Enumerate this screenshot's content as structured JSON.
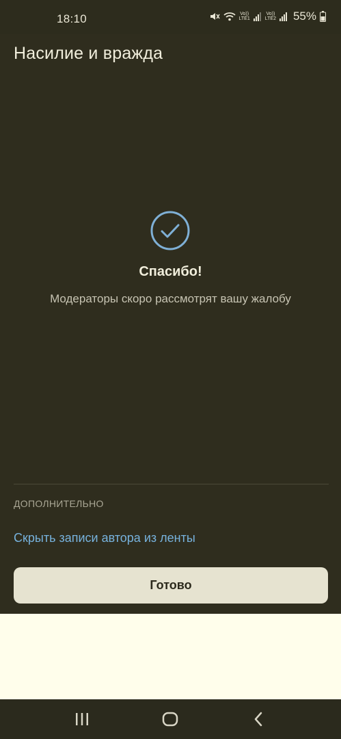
{
  "status_bar": {
    "time": "18:10",
    "lte1": "LTE1",
    "lte2": "LTE2",
    "volte": "Vo))",
    "battery": "55%",
    "icons": [
      "mute-icon",
      "wifi-icon",
      "signal-icon",
      "signal-icon",
      "battery-icon"
    ]
  },
  "header": {
    "title": "Насилие и вражда"
  },
  "confirmation": {
    "icon": "check-circle-icon",
    "title": "Спасибо!",
    "subtitle": "Модераторы скоро рассмотрят вашу жалобу"
  },
  "additional": {
    "section_label": "ДОПОЛНИТЕЛЬНО",
    "hide_author_link": "Скрыть записи автора из ленты"
  },
  "actions": {
    "done_label": "Готово"
  },
  "nav_bar": {
    "buttons": [
      "recent-apps-icon",
      "home-icon",
      "back-icon"
    ]
  },
  "colors": {
    "background": "#2f2d1e",
    "accent_link": "#77b2dd",
    "check_icon": "#7fb0d6",
    "button_bg": "#e6e3d0"
  }
}
